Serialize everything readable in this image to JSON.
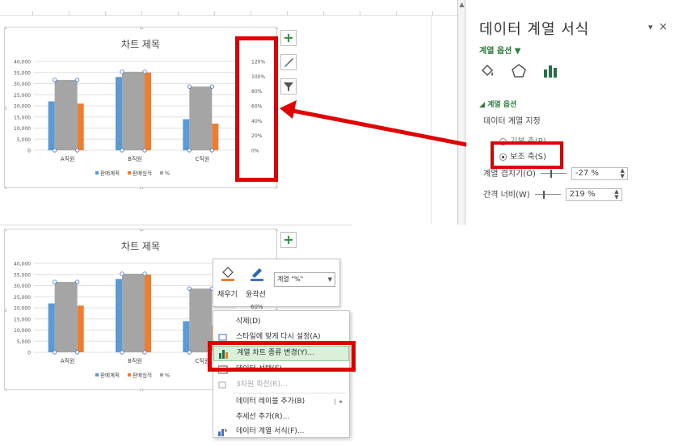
{
  "pane": {
    "title": "데이터 계열 서식",
    "subtitle": "계열 옵션 ▼",
    "section": "계열 옵션",
    "plot_on_label": "데이터 계열 지정",
    "primary_axis": "기본 축(P)",
    "secondary_axis": "보조 축(S)",
    "overlap_label": "계열 겹치기(O)",
    "overlap_value": "-27 %",
    "gap_label": "간격 너비(W)",
    "gap_value": "219 %",
    "selected_axis": "secondary"
  },
  "chart": {
    "title": "차트 제목",
    "categories": [
      "A직원",
      "B직원",
      "C직원"
    ],
    "y_ticks": [
      "0",
      "5,000",
      "10,000",
      "15,000",
      "20,000",
      "25,000",
      "30,000",
      "35,000",
      "40,000"
    ],
    "y2_ticks": [
      "0%",
      "20%",
      "40%",
      "60%",
      "80%",
      "100%",
      "120%"
    ],
    "legend": [
      "판매계획",
      "판매실적",
      "%"
    ],
    "colors": {
      "plan": "#5b9bd5",
      "actual": "#ed7d31",
      "pct": "#a5a5a5",
      "red": "#e10000"
    }
  },
  "chart_data": {
    "type": "bar",
    "categories": [
      "A직원",
      "B직원",
      "C직원"
    ],
    "series": [
      {
        "name": "판매계획",
        "values": [
          22000,
          33000,
          14000
        ]
      },
      {
        "name": "판매실적",
        "values": [
          21000,
          35000,
          12000
        ]
      },
      {
        "name": "%",
        "values": [
          0.95,
          1.06,
          0.86
        ]
      }
    ],
    "title": "차트 제목",
    "ylim": [
      0,
      40000
    ],
    "y2lim": [
      0,
      1.2
    ],
    "legend_position": "bottom"
  },
  "minitoolbar": {
    "fill_label": "채우기",
    "outline_label": "윤곽선",
    "series_select": "계열 \"%\""
  },
  "context_menu": {
    "items": [
      "삭제(D)",
      "스타일에 맞게 다시 설정(A)",
      "계열 차트 종류 변경(Y)...",
      "데이터 선택(E)...",
      "3차원 회전(R)...",
      "데이터 레이블 추가(B)",
      "추세선 추가(R)...",
      "데이터 계열 서식(F)..."
    ],
    "partial_tick": "60%"
  }
}
